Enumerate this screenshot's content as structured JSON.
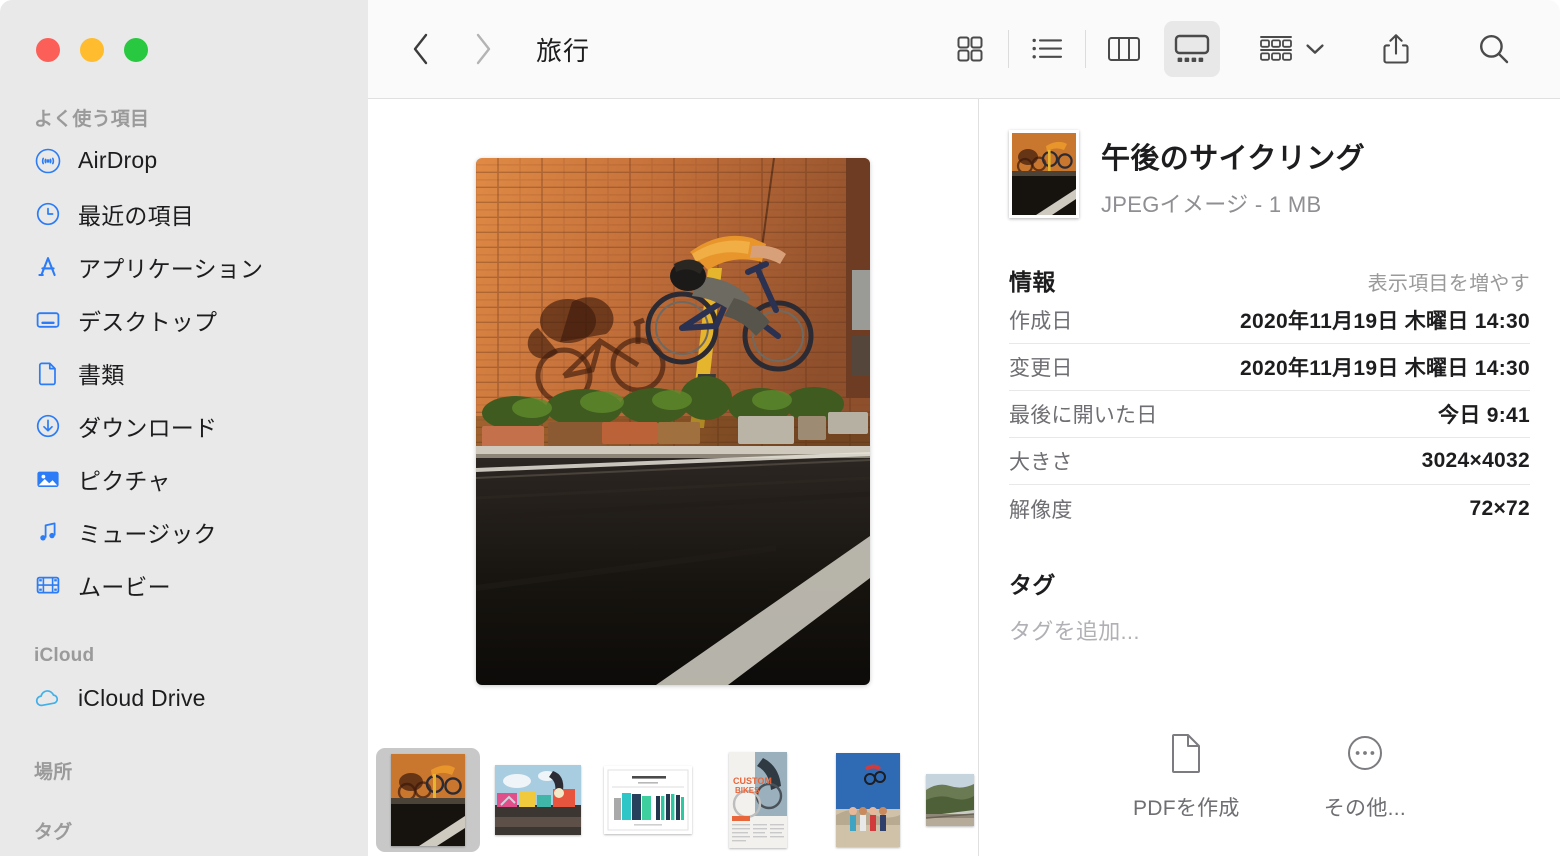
{
  "window": {
    "traffic_lights": [
      {
        "name": "close",
        "color": "#fc5f57"
      },
      {
        "name": "minimize",
        "color": "#febc2e"
      },
      {
        "name": "zoom",
        "color": "#28c840"
      }
    ]
  },
  "sidebar": {
    "sections": [
      {
        "header": "よく使う項目",
        "items": [
          {
            "label": "AirDrop",
            "icon": "airdrop-icon"
          },
          {
            "label": "最近の項目",
            "icon": "clock-icon"
          },
          {
            "label": "アプリケーション",
            "icon": "applications-icon"
          },
          {
            "label": "デスクトップ",
            "icon": "desktop-icon"
          },
          {
            "label": "書類",
            "icon": "document-icon"
          },
          {
            "label": "ダウンロード",
            "icon": "download-icon"
          },
          {
            "label": "ピクチャ",
            "icon": "pictures-icon"
          },
          {
            "label": "ミュージック",
            "icon": "music-icon"
          },
          {
            "label": "ムービー",
            "icon": "movies-icon"
          }
        ]
      },
      {
        "header": "iCloud",
        "items": [
          {
            "label": "iCloud Drive",
            "icon": "cloud-icon"
          }
        ]
      },
      {
        "header": "場所",
        "items": []
      },
      {
        "header": "タグ",
        "items": []
      }
    ]
  },
  "toolbar": {
    "back_label": "戻る",
    "forward_label": "進む",
    "title": "旅行",
    "views": [
      {
        "name": "icon-view",
        "label": "アイコン表示",
        "selected": false
      },
      {
        "name": "list-view",
        "label": "リスト表示",
        "selected": false
      },
      {
        "name": "column-view",
        "label": "カラム表示",
        "selected": false
      },
      {
        "name": "gallery-view",
        "label": "ギャラリー表示",
        "selected": true
      }
    ],
    "group_label": "グループ分け",
    "share_label": "共有",
    "search_label": "検索"
  },
  "preview": {
    "hero_alt": "BMXライダーがレンガの壁の前でジャンプしている写真",
    "thumbnails": [
      {
        "name": "bmx-wall-jump",
        "selected": true
      },
      {
        "name": "graffiti-skatepark",
        "selected": false
      },
      {
        "name": "chart-document",
        "selected": false
      },
      {
        "name": "custom-bikes-flyer",
        "selected": false
      },
      {
        "name": "bmx-blue-sky",
        "selected": false
      },
      {
        "name": "railroad-landscape",
        "selected": false
      }
    ]
  },
  "info": {
    "file_name": "午後のサイクリング",
    "file_kind": "JPEGイメージ - 1 MB",
    "section_title": "情報",
    "section_action": "表示項目を増やす",
    "metadata": [
      {
        "key": "作成日",
        "value": "2020年11月19日 木曜日 14:30"
      },
      {
        "key": "変更日",
        "value": "2020年11月19日 木曜日 14:30"
      },
      {
        "key": "最後に開いた日",
        "value": "今日 9:41"
      },
      {
        "key": "大きさ",
        "value": "3024×4032"
      },
      {
        "key": "解像度",
        "value": "72×72"
      }
    ],
    "tags_title": "タグ",
    "tags_placeholder": "タグを追加...",
    "actions": [
      {
        "label": "PDFを作成",
        "icon": "document-page-icon"
      },
      {
        "label": "その他...",
        "icon": "ellipsis-circle-icon"
      }
    ]
  },
  "colors": {
    "accent_blue": "#2b7cf6",
    "sidebar_bg": "#e9e9e9",
    "toolbar_bg": "#fafafa",
    "selected_thumb_bg": "#c8c8c8"
  }
}
